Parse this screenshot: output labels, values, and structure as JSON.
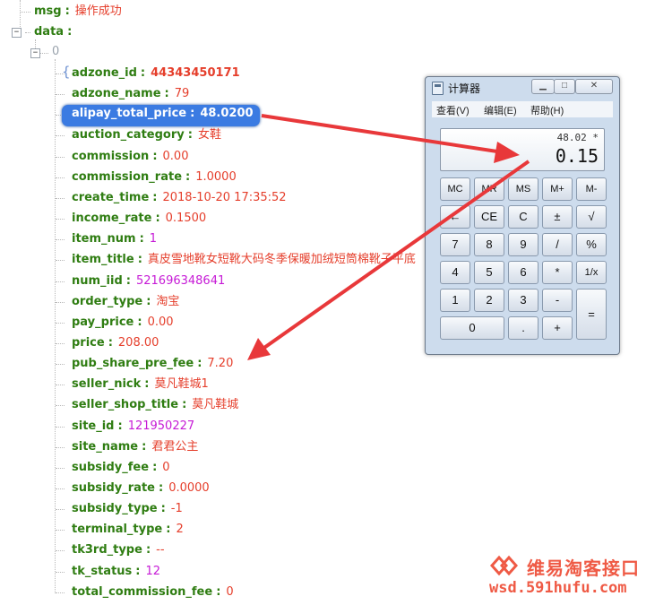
{
  "tree": {
    "top_fields": [
      {
        "key": "msg",
        "sep": ":",
        "value": "操作成功"
      },
      {
        "key": "data",
        "sep": ":",
        "value": ""
      }
    ],
    "index_label": "0",
    "toggle_symbol": "−",
    "fields": [
      {
        "key": "adzone_id",
        "sep": ":",
        "value": "44343450171",
        "value_style": "big"
      },
      {
        "key": "adzone_name",
        "sep": ":",
        "value": "79",
        "value_style": "red"
      },
      {
        "key": "alipay_total_price",
        "sep": ":",
        "value": "48.0200",
        "value_style": "highlight"
      },
      {
        "key": "auction_category",
        "sep": ":",
        "value": "女鞋",
        "value_style": "red"
      },
      {
        "key": "commission",
        "sep": ":",
        "value": "0.00",
        "value_style": "red"
      },
      {
        "key": "commission_rate",
        "sep": ":",
        "value": "1.0000",
        "value_style": "red"
      },
      {
        "key": "create_time",
        "sep": ":",
        "value": "2018-10-20 17:35:52",
        "value_style": "red"
      },
      {
        "key": "income_rate",
        "sep": ":",
        "value": "0.1500",
        "value_style": "red"
      },
      {
        "key": "item_num",
        "sep": ":",
        "value": "1",
        "value_style": "purple"
      },
      {
        "key": "item_title",
        "sep": ":",
        "value": "真皮雪地靴女短靴大码冬季保暖加绒短筒棉靴子平底",
        "value_style": "red"
      },
      {
        "key": "num_iid",
        "sep": ":",
        "value": "521696348641",
        "value_style": "purple"
      },
      {
        "key": "order_type",
        "sep": ":",
        "value": "淘宝",
        "value_style": "red"
      },
      {
        "key": "pay_price",
        "sep": ":",
        "value": "0.00",
        "value_style": "red"
      },
      {
        "key": "price",
        "sep": ":",
        "value": "208.00",
        "value_style": "red"
      },
      {
        "key": "pub_share_pre_fee",
        "sep": ":",
        "value": "7.20",
        "value_style": "red"
      },
      {
        "key": "seller_nick",
        "sep": ":",
        "value": "莫凡鞋城1",
        "value_style": "red"
      },
      {
        "key": "seller_shop_title",
        "sep": ":",
        "value": "莫凡鞋城",
        "value_style": "red"
      },
      {
        "key": "site_id",
        "sep": ":",
        "value": "121950227",
        "value_style": "purple"
      },
      {
        "key": "site_name",
        "sep": ":",
        "value": "君君公主",
        "value_style": "red"
      },
      {
        "key": "subsidy_fee",
        "sep": ":",
        "value": "0",
        "value_style": "red"
      },
      {
        "key": "subsidy_rate",
        "sep": ":",
        "value": "0.0000",
        "value_style": "red"
      },
      {
        "key": "subsidy_type",
        "sep": ":",
        "value": "-1",
        "value_style": "red"
      },
      {
        "key": "terminal_type",
        "sep": ":",
        "value": "2",
        "value_style": "red"
      },
      {
        "key": "tk3rd_type",
        "sep": ":",
        "value": "--",
        "value_style": "red"
      },
      {
        "key": "tk_status",
        "sep": ":",
        "value": "12",
        "value_style": "purple"
      },
      {
        "key": "total_commission_fee",
        "sep": ":",
        "value": "0",
        "value_style": "red"
      }
    ]
  },
  "calculator": {
    "title": "计算器",
    "window_buttons": {
      "minimize": "▁",
      "maximize": "□",
      "close": "✕"
    },
    "menu": [
      "查看(V)",
      "编辑(E)",
      "帮助(H)"
    ],
    "display": {
      "expression": "48.02 *",
      "value": "0.15"
    },
    "buttons": {
      "r1": [
        "MC",
        "MR",
        "MS",
        "M+",
        "M-"
      ],
      "r2": [
        "←",
        "CE",
        "C",
        "±",
        "√"
      ],
      "r3": [
        "7",
        "8",
        "9",
        "/",
        "%"
      ],
      "r4": [
        "4",
        "5",
        "6",
        "*",
        "1/x"
      ],
      "r5": [
        "1",
        "2",
        "3",
        "-"
      ],
      "r6": [
        "0",
        ".",
        "+"
      ],
      "equals": "="
    }
  },
  "annotations": {
    "arrow_color": "#e8383a"
  },
  "watermark": {
    "brand": "维易淘客接口",
    "url": "wsd.591hufu.com",
    "color": "#ef5a45"
  }
}
